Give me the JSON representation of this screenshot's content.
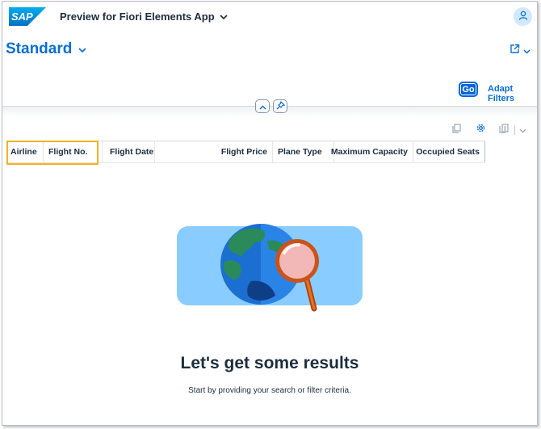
{
  "shell": {
    "logo_text": "SAP",
    "app_title": "Preview for Fiori Elements App",
    "avatar_icon": "person-icon"
  },
  "header": {
    "variant_title": "Standard",
    "share_icon": "share-icon"
  },
  "filter_bar": {
    "go_label": "Go",
    "adapt_label": "Adapt Filters"
  },
  "table": {
    "columns": [
      {
        "label": "Airline"
      },
      {
        "label": "Flight No."
      },
      {
        "label": "Flight Date"
      },
      {
        "label": "Flight Price"
      },
      {
        "label": "Plane Type"
      },
      {
        "label": "Maximum Capacity"
      },
      {
        "label": "Occupied Seats"
      }
    ],
    "toolbar_icons": [
      "copy-icon",
      "settings-icon",
      "export-icon",
      "chevron-down-icon"
    ]
  },
  "empty_state": {
    "title": "Let's get some results",
    "subtitle": "Start by providing your search or filter criteria."
  },
  "colors": {
    "brand": "#0a6ed1",
    "highlight": "#f0b323",
    "go_button": "#0064d9"
  }
}
